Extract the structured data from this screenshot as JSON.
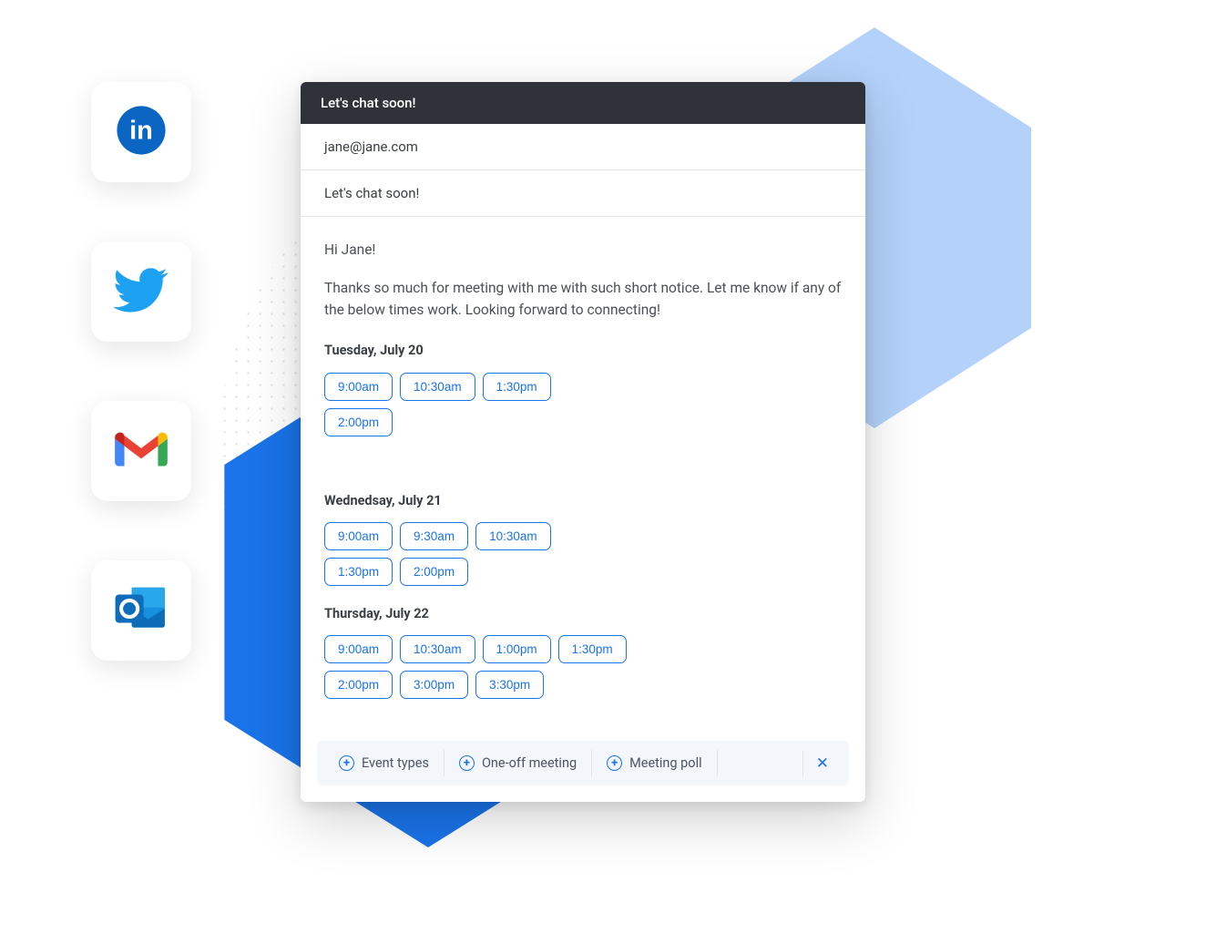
{
  "social": [
    {
      "name": "linkedin"
    },
    {
      "name": "twitter"
    },
    {
      "name": "gmail"
    },
    {
      "name": "outlook"
    }
  ],
  "compose": {
    "title": "Let's chat soon!",
    "to": "jane@jane.com",
    "subject": "Let's chat soon!",
    "greeting": "Hi Jane!",
    "message": "Thanks so much for meeting with me with such short notice. Let me know if any of the below times work. Looking forward to connecting!",
    "days": [
      {
        "label": "Tuesday, July 20",
        "slots": [
          "9:00am",
          "10:30am",
          "1:30pm",
          "2:00pm"
        ]
      },
      {
        "label": "Wednedsay, July 21",
        "slots": [
          "9:00am",
          "9:30am",
          "10:30am",
          "1:30pm",
          "2:00pm"
        ]
      },
      {
        "label": "Thursday, July 22",
        "slots": [
          "9:00am",
          "10:30am",
          "1:00pm",
          "1:30pm",
          "2:00pm",
          "3:00pm",
          "3:30pm"
        ]
      }
    ],
    "toolbar": {
      "event_types": "Event types",
      "one_off": "One-off meeting",
      "poll": "Meeting poll"
    }
  }
}
